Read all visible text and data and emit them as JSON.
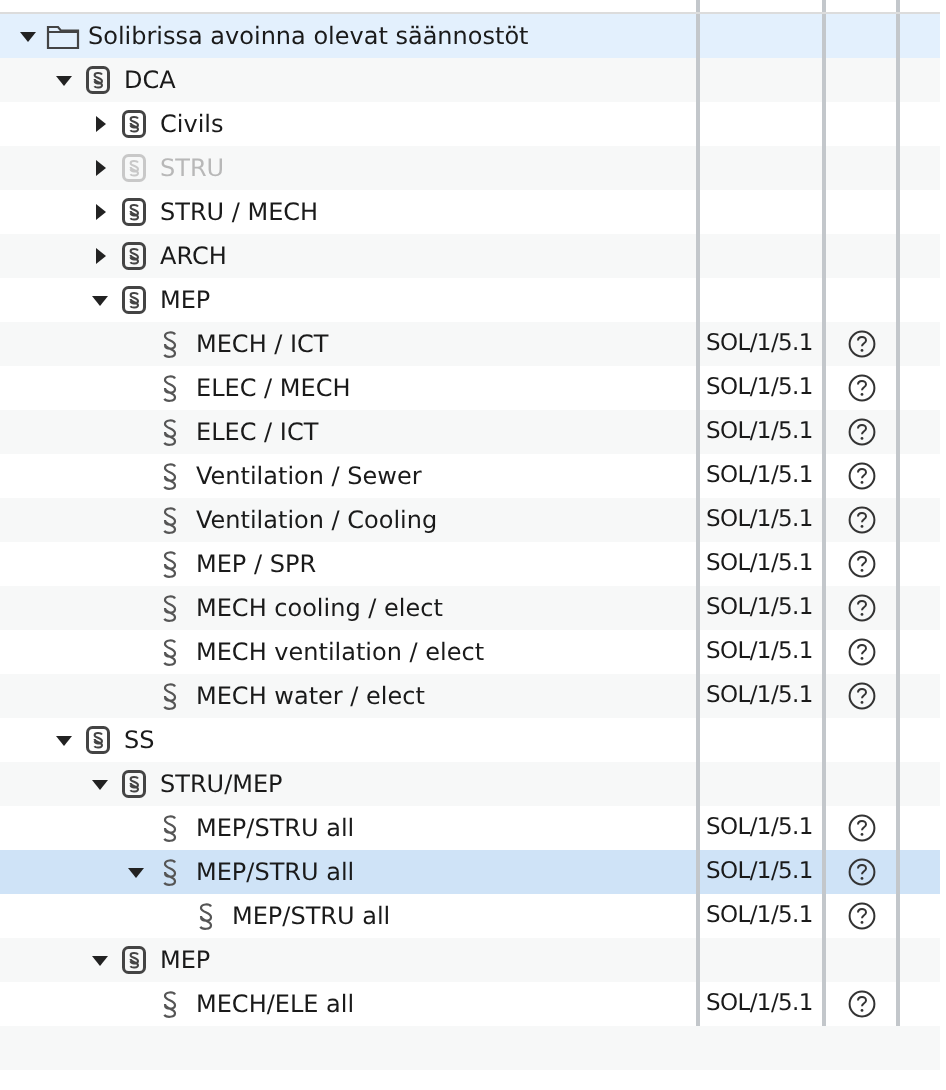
{
  "root": {
    "label": "Solibrissa avoinna olevat säännostöt",
    "expanded": true,
    "highlighted": true,
    "children": [
      {
        "kind": "ruleset",
        "label": "DCA",
        "expanded": true,
        "selected": false,
        "disabled": false,
        "children": [
          {
            "kind": "ruleset",
            "label": "Civils",
            "expanded": false,
            "selected": false,
            "disabled": false
          },
          {
            "kind": "ruleset",
            "label": "STRU",
            "expanded": false,
            "selected": false,
            "disabled": true
          },
          {
            "kind": "ruleset",
            "label": "STRU / MECH",
            "expanded": false,
            "selected": false,
            "disabled": false
          },
          {
            "kind": "ruleset",
            "label": "ARCH",
            "expanded": false,
            "selected": false,
            "disabled": false
          },
          {
            "kind": "ruleset",
            "label": "MEP",
            "expanded": true,
            "selected": false,
            "disabled": false,
            "children": [
              {
                "kind": "rule",
                "label": "MECH / ICT",
                "code": "SOL/1/5.1",
                "selected": false,
                "disabled": false
              },
              {
                "kind": "rule",
                "label": "ELEC / MECH",
                "code": "SOL/1/5.1",
                "selected": false,
                "disabled": false
              },
              {
                "kind": "rule",
                "label": "ELEC / ICT",
                "code": "SOL/1/5.1",
                "selected": false,
                "disabled": false
              },
              {
                "kind": "rule",
                "label": "Ventilation / Sewer",
                "code": "SOL/1/5.1",
                "selected": false,
                "disabled": false
              },
              {
                "kind": "rule",
                "label": "Ventilation / Cooling",
                "code": "SOL/1/5.1",
                "selected": false,
                "disabled": false
              },
              {
                "kind": "rule",
                "label": "MEP / SPR",
                "code": "SOL/1/5.1",
                "selected": false,
                "disabled": false
              },
              {
                "kind": "rule",
                "label": "MECH cooling / elect",
                "code": "SOL/1/5.1",
                "selected": false,
                "disabled": false
              },
              {
                "kind": "rule",
                "label": "MECH ventilation / elect",
                "code": "SOL/1/5.1",
                "selected": false,
                "disabled": false
              },
              {
                "kind": "rule",
                "label": "MECH water / elect",
                "code": "SOL/1/5.1",
                "selected": false,
                "disabled": false
              }
            ]
          }
        ]
      },
      {
        "kind": "ruleset",
        "label": "SS",
        "expanded": true,
        "selected": false,
        "disabled": false,
        "children": [
          {
            "kind": "ruleset",
            "label": "STRU/MEP",
            "expanded": true,
            "selected": false,
            "disabled": false,
            "children": [
              {
                "kind": "rule",
                "label": "MEP/STRU all",
                "code": "SOL/1/5.1",
                "selected": false,
                "disabled": false
              },
              {
                "kind": "rule",
                "label": "MEP/STRU all",
                "code": "SOL/1/5.1",
                "expanded": true,
                "selected": true,
                "disabled": false,
                "children": [
                  {
                    "kind": "rule",
                    "label": "MEP/STRU all",
                    "code": "SOL/1/5.1",
                    "selected": false,
                    "disabled": false
                  }
                ]
              }
            ]
          },
          {
            "kind": "ruleset",
            "label": "MEP",
            "expanded": true,
            "selected": false,
            "disabled": false,
            "children": [
              {
                "kind": "rule",
                "label": "MECH/ELE all",
                "code": "SOL/1/5.1",
                "selected": false,
                "disabled": false
              }
            ]
          }
        ]
      }
    ]
  }
}
